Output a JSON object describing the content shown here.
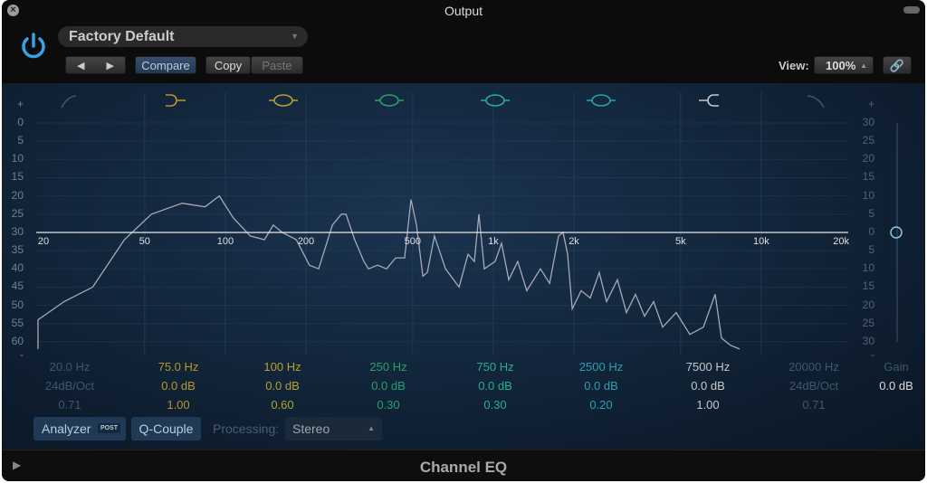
{
  "window": {
    "title": "Output",
    "plugin_name": "Channel EQ"
  },
  "header": {
    "preset": "Factory Default",
    "compare": "Compare",
    "copy": "Copy",
    "paste": "Paste",
    "view_label": "View:",
    "view_value": "100%",
    "prev_icon": "triangle-left",
    "next_icon": "triangle-right",
    "link_icon": "link-icon"
  },
  "colors": {
    "accent": "#3aa0e8",
    "panel": "#12253a"
  },
  "left_scale": [
    "+",
    "0",
    "5",
    "10",
    "15",
    "20",
    "25",
    "30",
    "35",
    "40",
    "45",
    "50",
    "55",
    "60",
    "-"
  ],
  "right_scale": [
    "+",
    "30",
    "25",
    "20",
    "15",
    "10",
    "5",
    "0",
    "5",
    "10",
    "15",
    "20",
    "25",
    "30",
    "-"
  ],
  "freq_labels": [
    "20",
    "50",
    "100",
    "200",
    "500",
    "1k",
    "2k",
    "5k",
    "10k",
    "20k"
  ],
  "bands": [
    {
      "freq": "20.0 Hz",
      "gain": "24dB/Oct",
      "q": "0.71",
      "color": "#3f576b",
      "type": "high-pass",
      "enabled": false
    },
    {
      "freq": "75.0 Hz",
      "gain": "0.0 dB",
      "q": "1.00",
      "color": "#b8952e",
      "type": "low-shelf",
      "enabled": true
    },
    {
      "freq": "100 Hz",
      "gain": "0.0 dB",
      "q": "0.60",
      "color": "#b4a132",
      "type": "bell",
      "enabled": true
    },
    {
      "freq": "250 Hz",
      "gain": "0.0 dB",
      "q": "0.30",
      "color": "#2a9f6c",
      "type": "bell",
      "enabled": true
    },
    {
      "freq": "750 Hz",
      "gain": "0.0 dB",
      "q": "0.30",
      "color": "#27b08e",
      "type": "bell",
      "enabled": true
    },
    {
      "freq": "2500 Hz",
      "gain": "0.0 dB",
      "q": "0.20",
      "color": "#2d9fb0",
      "type": "bell",
      "enabled": true
    },
    {
      "freq": "7500 Hz",
      "gain": "0.0 dB",
      "q": "1.00",
      "color": "#c8c8c8",
      "type": "high-shelf",
      "enabled": true
    },
    {
      "freq": "20000 Hz",
      "gain": "24dB/Oct",
      "q": "0.71",
      "color": "#3f576b",
      "type": "low-pass",
      "enabled": false
    }
  ],
  "gain": {
    "label": "Gain",
    "value": "0.0 dB"
  },
  "footer": {
    "analyzer": "Analyzer",
    "post": "POST",
    "qcouple": "Q-Couple",
    "processing_label": "Processing:",
    "processing_value": "Stereo"
  },
  "chart_data": {
    "type": "line",
    "xscale": "log",
    "xlim": [
      20,
      20000
    ],
    "analyzer_ylim": [
      0,
      60
    ],
    "eq_gain_db": 0,
    "analyzer": [
      [
        20,
        62
      ],
      [
        20,
        54
      ],
      [
        25,
        49
      ],
      [
        32,
        45
      ],
      [
        42,
        32
      ],
      [
        53,
        25
      ],
      [
        69,
        22
      ],
      [
        84,
        23
      ],
      [
        95,
        20
      ],
      [
        107,
        26
      ],
      [
        124,
        31
      ],
      [
        140,
        32
      ],
      [
        151,
        28
      ],
      [
        163,
        30
      ],
      [
        184,
        32
      ],
      [
        206,
        39
      ],
      [
        223,
        40
      ],
      [
        251,
        28
      ],
      [
        271,
        25
      ],
      [
        282,
        25
      ],
      [
        304,
        32
      ],
      [
        329,
        38
      ],
      [
        342,
        40
      ],
      [
        370,
        39
      ],
      [
        400,
        40
      ],
      [
        432,
        37
      ],
      [
        467,
        37
      ],
      [
        493,
        21
      ],
      [
        517,
        28
      ],
      [
        546,
        42
      ],
      [
        567,
        41
      ],
      [
        603,
        31
      ],
      [
        663,
        40
      ],
      [
        745,
        45
      ],
      [
        805,
        36
      ],
      [
        850,
        38
      ],
      [
        884,
        25
      ],
      [
        926,
        40
      ],
      [
        1016,
        38
      ],
      [
        1073,
        33
      ],
      [
        1142,
        43
      ],
      [
        1234,
        38
      ],
      [
        1334,
        46
      ],
      [
        1500,
        40
      ],
      [
        1622,
        44
      ],
      [
        1752,
        31
      ],
      [
        1822,
        30
      ],
      [
        1894,
        36
      ],
      [
        1970,
        51
      ],
      [
        2128,
        46
      ],
      [
        2300,
        48
      ],
      [
        2486,
        41
      ],
      [
        2646,
        49
      ],
      [
        2906,
        43
      ],
      [
        3140,
        52
      ],
      [
        3394,
        47
      ],
      [
        3668,
        53
      ],
      [
        3966,
        49
      ],
      [
        4288,
        56
      ],
      [
        4818,
        52
      ],
      [
        5412,
        58
      ],
      [
        6082,
        56
      ],
      [
        6730,
        47
      ],
      [
        7106,
        59
      ],
      [
        7684,
        61
      ],
      [
        8304,
        62
      ]
    ]
  }
}
